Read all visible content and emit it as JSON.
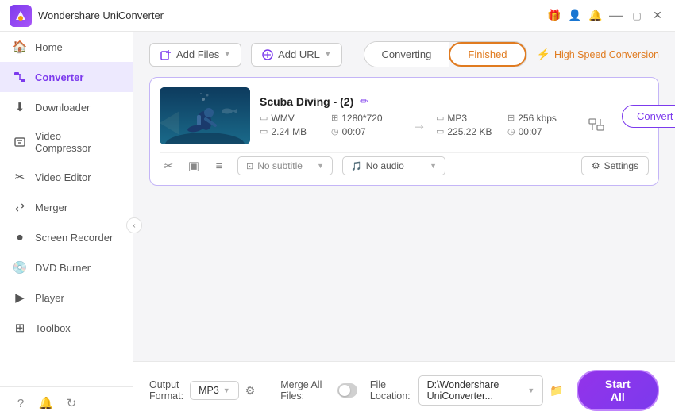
{
  "app": {
    "title": "Wondershare UniConverter",
    "logo_char": "W"
  },
  "titlebar": {
    "icons": [
      "gift-icon",
      "user-icon",
      "bell-icon",
      "minimize-icon",
      "maximize-icon",
      "close-icon"
    ]
  },
  "sidebar": {
    "items": [
      {
        "label": "Home",
        "icon": "🏠",
        "active": false
      },
      {
        "label": "Converter",
        "icon": "🔄",
        "active": true
      },
      {
        "label": "Downloader",
        "icon": "⬇️",
        "active": false
      },
      {
        "label": "Video Compressor",
        "icon": "🗜️",
        "active": false
      },
      {
        "label": "Video Editor",
        "icon": "✂️",
        "active": false
      },
      {
        "label": "Merger",
        "icon": "🔀",
        "active": false
      },
      {
        "label": "Screen Recorder",
        "icon": "🎥",
        "active": false
      },
      {
        "label": "DVD Burner",
        "icon": "💿",
        "active": false
      },
      {
        "label": "Player",
        "icon": "▶️",
        "active": false
      },
      {
        "label": "Toolbox",
        "icon": "🧰",
        "active": false
      }
    ],
    "bottom_icons": [
      "help-icon",
      "notification-icon",
      "feedback-icon"
    ]
  },
  "toolbar": {
    "add_files_label": "Add Files",
    "add_url_label": "Add URL",
    "tab_converting": "Converting",
    "tab_finished": "Finished",
    "high_speed_label": "High Speed Conversion"
  },
  "file_card": {
    "title": "Scuba Diving - (2)",
    "source": {
      "format": "WMV",
      "resolution": "1280*720",
      "size": "2.24 MB",
      "duration": "00:07"
    },
    "target": {
      "format": "MP3",
      "bitrate": "256 kbps",
      "size": "225.22 KB",
      "duration": "00:07"
    },
    "subtitle_label": "No subtitle",
    "audio_label": "No audio",
    "settings_label": "Settings",
    "convert_btn_label": "Convert"
  },
  "bottom_bar": {
    "output_format_label": "Output Format:",
    "output_format_value": "MP3",
    "file_location_label": "File Location:",
    "file_location_value": "D:\\Wondershare UniConverter...",
    "merge_files_label": "Merge All Files:",
    "start_all_label": "Start All"
  },
  "colors": {
    "accent": "#7c3aed",
    "orange": "#e07b20",
    "border_active": "#c4b5f7"
  }
}
